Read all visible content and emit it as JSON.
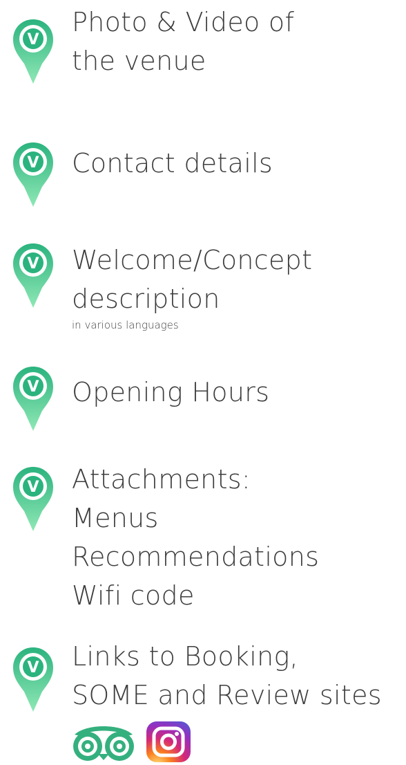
{
  "features": [
    {
      "id": "photo-video",
      "lines": [
        "Photo & Video of",
        "the venue"
      ],
      "note": ""
    },
    {
      "id": "contact",
      "lines": [
        "Contact details"
      ],
      "note": ""
    },
    {
      "id": "welcome",
      "lines": [
        "Welcome/Concept",
        "description"
      ],
      "note": "in various languages"
    },
    {
      "id": "opening-hours",
      "lines": [
        "Opening Hours"
      ],
      "note": ""
    },
    {
      "id": "attachments",
      "lines": [
        "Attachments:",
        "Menus",
        "Recommendations",
        "Wifi code"
      ],
      "note": ""
    },
    {
      "id": "links",
      "lines": [
        "Links to Booking,",
        "SOME and Review sites"
      ],
      "note": ""
    }
  ],
  "pin_icon": {
    "name": "venue-pin-icon",
    "letter": "V",
    "color_top": "#2bb37e",
    "color_bottom": "#8fe8b5"
  },
  "social_icons": [
    {
      "name": "tripadvisor-icon",
      "color": "#34b07e"
    },
    {
      "name": "instagram-icon",
      "colors": [
        "#feda75",
        "#fa7e1e",
        "#d62976",
        "#962fbf",
        "#4f5bd5"
      ]
    }
  ]
}
